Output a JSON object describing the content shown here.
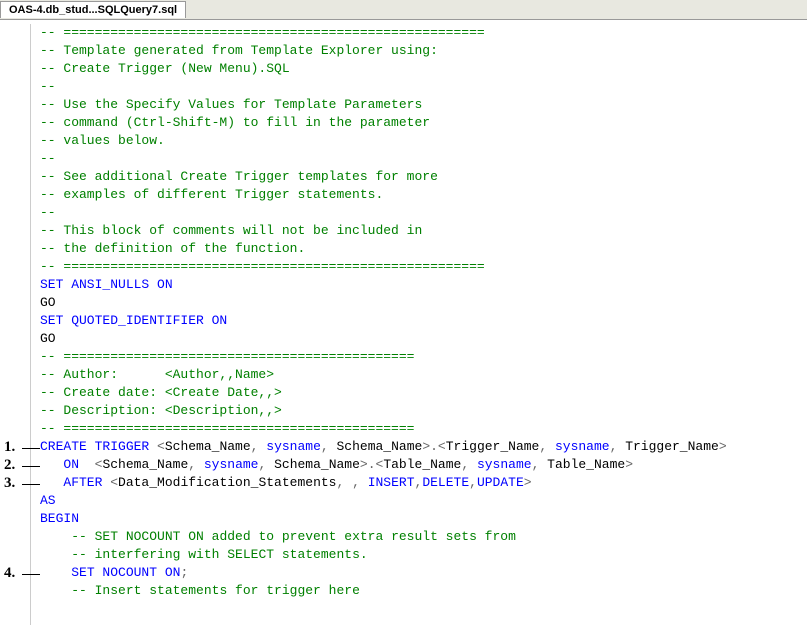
{
  "tab": {
    "title": "OAS-4.db_stud...SQLQuery7.sql"
  },
  "lines": [
    {
      "segments": [
        {
          "t": "-- ======================================================",
          "cls": "comment"
        }
      ]
    },
    {
      "segments": [
        {
          "t": "-- Template generated from Template Explorer using:",
          "cls": "comment"
        }
      ]
    },
    {
      "segments": [
        {
          "t": "-- Create Trigger (New Menu).SQL",
          "cls": "comment"
        }
      ]
    },
    {
      "segments": [
        {
          "t": "--",
          "cls": "comment"
        }
      ]
    },
    {
      "segments": [
        {
          "t": "-- Use the Specify Values for Template Parameters",
          "cls": "comment"
        }
      ]
    },
    {
      "segments": [
        {
          "t": "-- command (Ctrl-Shift-M) to fill in the parameter",
          "cls": "comment"
        }
      ]
    },
    {
      "segments": [
        {
          "t": "-- values below.",
          "cls": "comment"
        }
      ]
    },
    {
      "segments": [
        {
          "t": "--",
          "cls": "comment"
        }
      ]
    },
    {
      "segments": [
        {
          "t": "-- See additional Create Trigger templates for more",
          "cls": "comment"
        }
      ]
    },
    {
      "segments": [
        {
          "t": "-- examples of different Trigger statements.",
          "cls": "comment"
        }
      ]
    },
    {
      "segments": [
        {
          "t": "--",
          "cls": "comment"
        }
      ]
    },
    {
      "segments": [
        {
          "t": "-- This block of comments will not be included in",
          "cls": "comment"
        }
      ]
    },
    {
      "segments": [
        {
          "t": "-- the definition of the function.",
          "cls": "comment"
        }
      ]
    },
    {
      "segments": [
        {
          "t": "-- ======================================================",
          "cls": "comment"
        }
      ]
    },
    {
      "segments": [
        {
          "t": "SET ANSI_NULLS ON",
          "cls": "keyword"
        }
      ]
    },
    {
      "segments": [
        {
          "t": "GO",
          "cls": "plain"
        }
      ]
    },
    {
      "segments": [
        {
          "t": "SET QUOTED_IDENTIFIER ON",
          "cls": "keyword"
        }
      ]
    },
    {
      "segments": [
        {
          "t": "GO",
          "cls": "plain"
        }
      ]
    },
    {
      "segments": [
        {
          "t": "-- =============================================",
          "cls": "comment"
        }
      ]
    },
    {
      "segments": [
        {
          "t": "-- Author:      <Author,,Name>",
          "cls": "comment"
        }
      ]
    },
    {
      "segments": [
        {
          "t": "-- Create date: <Create Date,,>",
          "cls": "comment"
        }
      ]
    },
    {
      "segments": [
        {
          "t": "-- Description: <Description,,>",
          "cls": "comment"
        }
      ]
    },
    {
      "segments": [
        {
          "t": "-- =============================================",
          "cls": "comment"
        }
      ]
    },
    {
      "segments": [
        {
          "t": "CREATE TRIGGER ",
          "cls": "keyword"
        },
        {
          "t": "<",
          "cls": "gray"
        },
        {
          "t": "Schema_Name",
          "cls": "plain"
        },
        {
          "t": ", ",
          "cls": "gray"
        },
        {
          "t": "sysname",
          "cls": "keyword"
        },
        {
          "t": ", ",
          "cls": "gray"
        },
        {
          "t": "Schema_Name",
          "cls": "plain"
        },
        {
          "t": ">.<",
          "cls": "gray"
        },
        {
          "t": "Trigger_Name",
          "cls": "plain"
        },
        {
          "t": ", ",
          "cls": "gray"
        },
        {
          "t": "sysname",
          "cls": "keyword"
        },
        {
          "t": ", ",
          "cls": "gray"
        },
        {
          "t": "Trigger_Name",
          "cls": "plain"
        },
        {
          "t": ">",
          "cls": "gray"
        }
      ],
      "annot": "1."
    },
    {
      "segments": [
        {
          "t": "   ",
          "cls": "plain"
        },
        {
          "t": "ON",
          "cls": "keyword"
        },
        {
          "t": "  ",
          "cls": "plain"
        },
        {
          "t": "<",
          "cls": "gray"
        },
        {
          "t": "Schema_Name",
          "cls": "plain"
        },
        {
          "t": ", ",
          "cls": "gray"
        },
        {
          "t": "sysname",
          "cls": "keyword"
        },
        {
          "t": ", ",
          "cls": "gray"
        },
        {
          "t": "Schema_Name",
          "cls": "plain"
        },
        {
          "t": ">.<",
          "cls": "gray"
        },
        {
          "t": "Table_Name",
          "cls": "plain"
        },
        {
          "t": ", ",
          "cls": "gray"
        },
        {
          "t": "sysname",
          "cls": "keyword"
        },
        {
          "t": ", ",
          "cls": "gray"
        },
        {
          "t": "Table_Name",
          "cls": "plain"
        },
        {
          "t": ">",
          "cls": "gray"
        }
      ],
      "annot": "2."
    },
    {
      "segments": [
        {
          "t": "   ",
          "cls": "plain"
        },
        {
          "t": "AFTER ",
          "cls": "keyword"
        },
        {
          "t": "<",
          "cls": "gray"
        },
        {
          "t": "Data_Modification_Statements",
          "cls": "plain"
        },
        {
          "t": ", , ",
          "cls": "gray"
        },
        {
          "t": "INSERT",
          "cls": "keyword"
        },
        {
          "t": ",",
          "cls": "gray"
        },
        {
          "t": "DELETE",
          "cls": "keyword"
        },
        {
          "t": ",",
          "cls": "gray"
        },
        {
          "t": "UPDATE",
          "cls": "keyword"
        },
        {
          "t": ">",
          "cls": "gray"
        }
      ],
      "annot": "3."
    },
    {
      "segments": [
        {
          "t": "AS",
          "cls": "keyword"
        }
      ]
    },
    {
      "segments": [
        {
          "t": "BEGIN",
          "cls": "keyword"
        }
      ]
    },
    {
      "segments": [
        {
          "t": "    ",
          "cls": "plain"
        },
        {
          "t": "-- SET NOCOUNT ON added to prevent extra result sets from",
          "cls": "comment"
        }
      ]
    },
    {
      "segments": [
        {
          "t": "    ",
          "cls": "plain"
        },
        {
          "t": "-- interfering with SELECT statements.",
          "cls": "comment"
        }
      ]
    },
    {
      "segments": [
        {
          "t": "    ",
          "cls": "plain"
        },
        {
          "t": "SET NOCOUNT ON",
          "cls": "keyword"
        },
        {
          "t": ";",
          "cls": "gray"
        }
      ],
      "annot": "4."
    },
    {
      "segments": [
        {
          "t": "",
          "cls": "plain"
        }
      ]
    },
    {
      "segments": [
        {
          "t": "    ",
          "cls": "plain"
        },
        {
          "t": "-- Insert statements for trigger here",
          "cls": "comment"
        }
      ]
    }
  ]
}
